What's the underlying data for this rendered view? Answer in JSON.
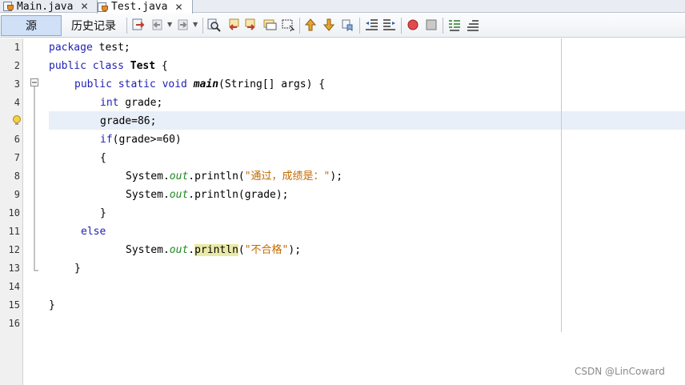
{
  "tabs": [
    {
      "label": "Main.java",
      "close": "✕",
      "active": false
    },
    {
      "label": "Test.java",
      "close": "✕",
      "active": true
    }
  ],
  "toolbar": {
    "source_label": "源",
    "history_label": "历史记录",
    "icons": [
      "last-edit-icon",
      "back-icon",
      "forward-icon",
      "find-icon",
      "find-previous-icon",
      "find-next-icon",
      "toggle-highlight-icon",
      "toggle-rect-select-icon",
      "previous-bookmark-icon",
      "next-bookmark-icon",
      "toggle-bookmark-icon",
      "shift-left-icon",
      "shift-right-icon",
      "start-macro-icon",
      "stop-macro-icon",
      "comment-icon",
      "uncomment-icon"
    ]
  },
  "editor": {
    "line_numbers": [
      "1",
      "2",
      "3",
      "4",
      "5",
      "6",
      "7",
      "8",
      "9",
      "10",
      "11",
      "12",
      "13",
      "14",
      "15",
      "16"
    ],
    "current_line": 5,
    "hint_icon_line": 5
  },
  "code": {
    "l1_kw": "package",
    "l1_rest": " test;",
    "l2_kw": "public class",
    "l2_cls": "Test",
    "l2_rest": " {",
    "l3_kw": "public static void",
    "l3_mth": "main",
    "l3_rest": "(String[] args) {",
    "l4_kw": "int",
    "l4_rest": " grade;",
    "l5_text": "grade=86;",
    "l6_kw": "if",
    "l6_rest": "(grade>=60)",
    "l7_text": "{",
    "l8_a": "System.",
    "l8_fld": "out",
    "l8_b": ".println(",
    "l8_str": "\"通过，成绩是：\"",
    "l8_c": ");",
    "l9_a": "System.",
    "l9_fld": "out",
    "l9_b": ".println(grade);",
    "l10_text": "}",
    "l11_kw": "else",
    "l12_a": "System.",
    "l12_fld": "out",
    "l12_dot": ".",
    "l12_mark": "println",
    "l12_b": "(",
    "l12_str": "\"不合格\"",
    "l12_c": ");",
    "l13_text": "}",
    "l15_text": "}"
  },
  "watermark": "CSDN @LinCoward",
  "colors": {
    "keyword": "#1f1fb5",
    "field": "#1e8a1e",
    "string": "#c26a00",
    "current_line": "#e9eff8",
    "occurrence_mark": "#eaeaa7"
  }
}
